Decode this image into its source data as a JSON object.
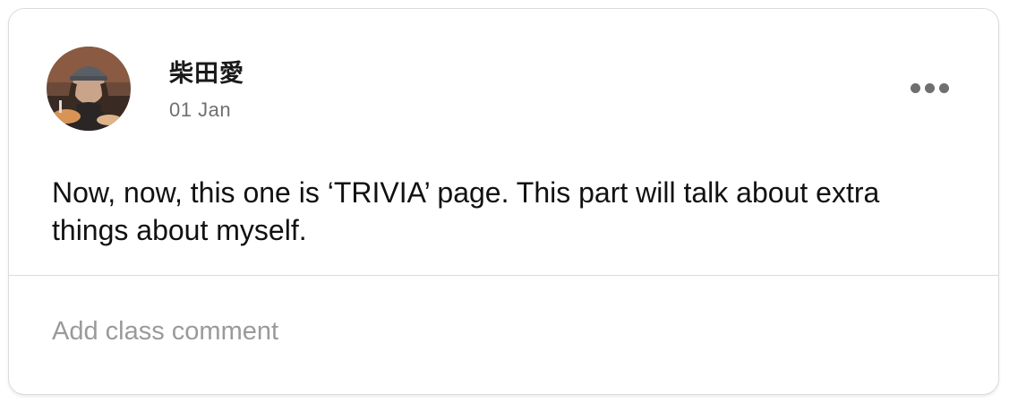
{
  "post": {
    "author": {
      "name": "柴田愛",
      "avatar_icon": "user-photo-avatar"
    },
    "date": "01 Jan",
    "more_icon": "more-horizontal-icon",
    "body": "Now, now, this one is ‘TRIVIA’ page. This part will talk about extra things about myself."
  },
  "comment": {
    "placeholder": "Add class comment"
  },
  "colors": {
    "text_primary": "#111111",
    "text_secondary": "#6f6f6f",
    "placeholder": "#9a9a9a",
    "border": "#dcdcdc"
  }
}
